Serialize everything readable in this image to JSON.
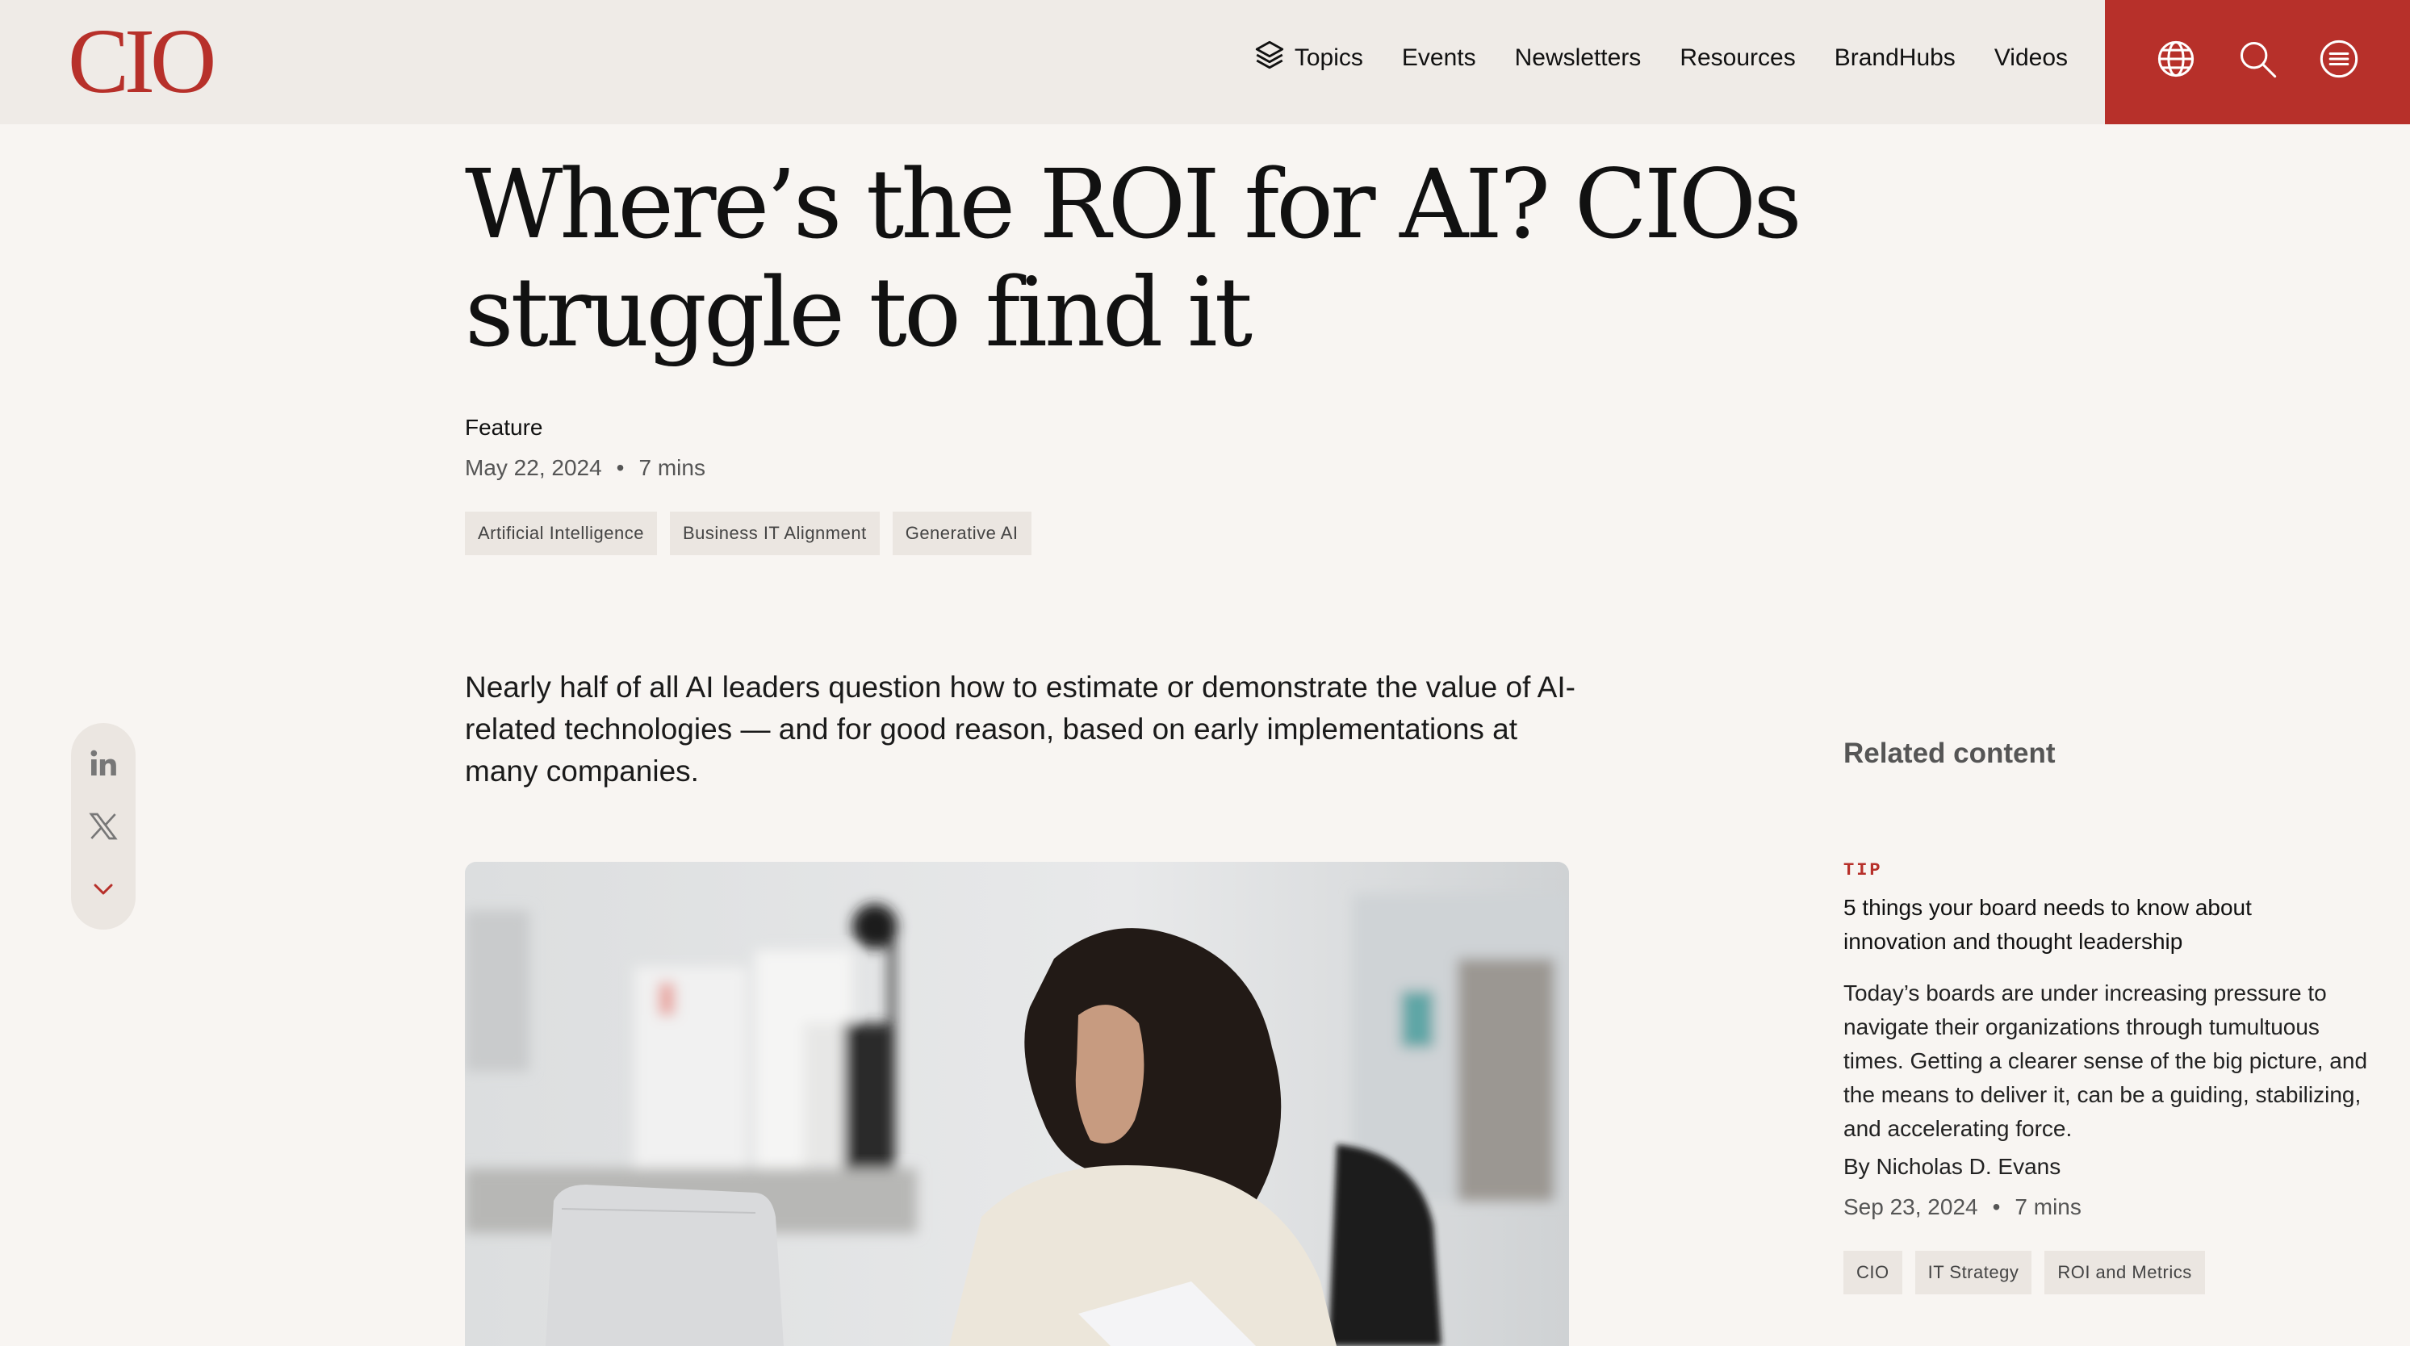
{
  "header": {
    "logo_text": "CIO",
    "nav": [
      {
        "label": "Topics",
        "icon": "layers-icon"
      },
      {
        "label": "Events"
      },
      {
        "label": "Newsletters"
      },
      {
        "label": "Resources"
      },
      {
        "label": "BrandHubs"
      },
      {
        "label": "Videos"
      }
    ],
    "utility_icons": [
      "globe-icon",
      "search-icon",
      "menu-icon"
    ],
    "brand_color": "#b7302a"
  },
  "article": {
    "title": "Where’s the ROI for AI? CIOs struggle to find it",
    "kind": "Feature",
    "date": "May 22, 2024",
    "separator": "•",
    "read_time": "7 mins",
    "tags": [
      "Artificial Intelligence",
      "Business IT Alignment",
      "Generative AI"
    ],
    "lead": "Nearly half of all AI leaders question how to estimate or demonstrate the value of AI-related technologies — and for good reason, based on early implementations at many companies."
  },
  "share": {
    "icons": [
      "linkedin-icon",
      "x-icon",
      "chevron-down-icon"
    ]
  },
  "related": {
    "heading": "Related content",
    "kicker": "TIP",
    "title": "5 things your board needs to know about innovation and thought leadership",
    "description": "Today’s boards are under increasing pressure to navigate their organizations through tumultuous times. Getting a clearer sense of the big picture, and the means to deliver it, can be a guiding, stabilizing, and accelerating force.",
    "author": "By Nicholas D. Evans",
    "date": "Sep 23, 2024",
    "separator": "•",
    "read_time": "7 mins",
    "tags": [
      "CIO",
      "IT Strategy",
      "ROI and Metrics"
    ]
  }
}
